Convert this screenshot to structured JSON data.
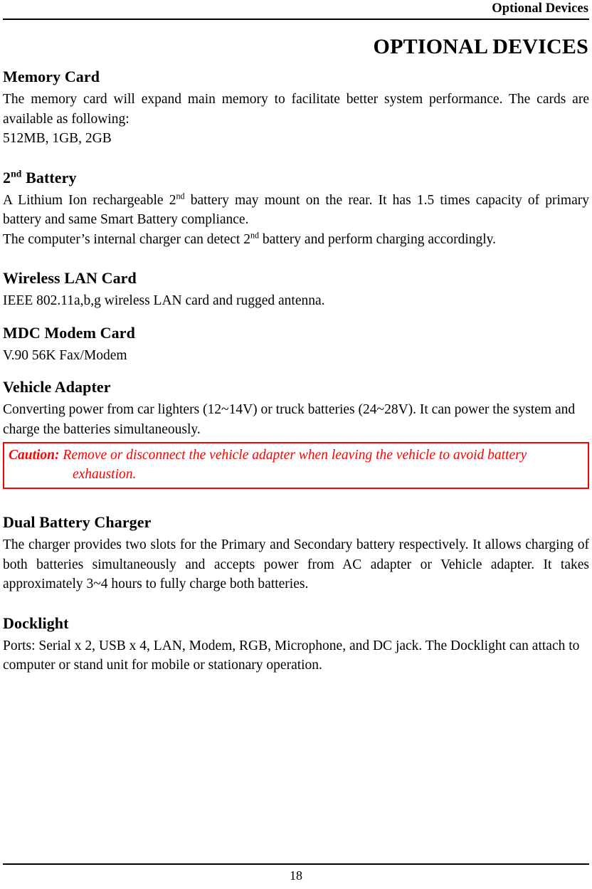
{
  "header": {
    "running_title": "Optional Devices"
  },
  "document": {
    "title": "OPTIONAL DEVICES"
  },
  "sections": [
    {
      "id": "memory-card",
      "heading": "Memory Card",
      "paragraphs": [
        "The memory card will expand main memory to facilitate better system performance. The cards are available as following:",
        "512MB, 1GB, 2GB"
      ]
    },
    {
      "id": "second-battery",
      "heading_prefix": "2",
      "heading_sup": "nd",
      "heading_suffix": " Battery",
      "paragraph_1_part_1": "A Lithium Ion rechargeable 2",
      "paragraph_1_sup": "nd",
      "paragraph_1_part_2": " battery may mount on the rear. It has 1.5 times capacity of primary battery and same Smart Battery compliance.",
      "paragraph_2_part_1": "The computer’s internal charger can detect 2",
      "paragraph_2_sup": "nd",
      "paragraph_2_part_2": " battery and perform charging accordingly."
    },
    {
      "id": "wireless-lan-card",
      "heading": "Wireless LAN Card",
      "paragraphs": [
        "IEEE 802.11a,b,g wireless LAN card and rugged antenna."
      ]
    },
    {
      "id": "mdc-modem-card",
      "heading": "MDC Modem Card",
      "paragraphs": [
        "V.90 56K Fax/Modem"
      ]
    },
    {
      "id": "vehicle-adapter",
      "heading": "Vehicle Adapter",
      "paragraphs": [
        "Converting power from car lighters (12~14V) or truck batteries (24~28V). It can power the system and charge the batteries simultaneously."
      ],
      "caution": {
        "label": "Caution:",
        "text": " Remove or disconnect the vehicle adapter when leaving the vehicle to avoid battery exhaustion.",
        "border_color": "#ff0000",
        "text_color": "#ff0000"
      }
    },
    {
      "id": "dual-battery-charger",
      "heading": "Dual Battery Charger",
      "paragraphs": [
        "The charger provides two slots for the Primary and Secondary battery respectively. It allows charging of both batteries simultaneously and accepts power from AC adapter or Vehicle adapter. It takes approximately 3~4 hours to fully charge both batteries."
      ]
    },
    {
      "id": "docklight",
      "heading": "Docklight",
      "paragraphs": [
        "Ports: Serial x 2, USB x 4, LAN, Modem, RGB, Microphone, and DC jack. The Docklight can attach to computer or stand unit for mobile or stationary operation."
      ]
    }
  ],
  "footer": {
    "page_number": "18"
  }
}
